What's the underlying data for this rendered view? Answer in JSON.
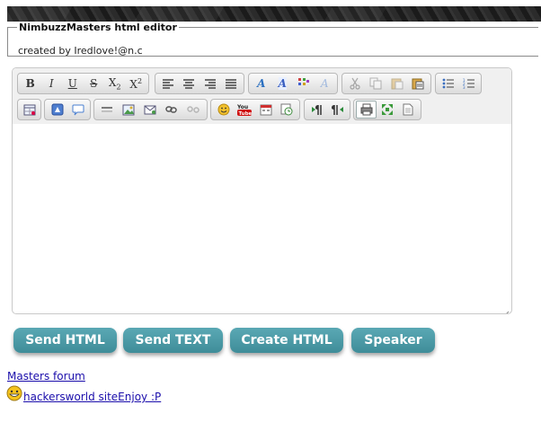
{
  "header": {
    "legend": "NimbuzzMasters html editor",
    "credit": "created by Iredlove!@n.c"
  },
  "toolbar": {
    "row1": [
      {
        "icon": "bold-icon",
        "label": "B"
      },
      {
        "icon": "italic-icon",
        "label": "I"
      },
      {
        "icon": "underline-icon",
        "label": "U"
      },
      {
        "icon": "strikethrough-icon",
        "label": "S"
      },
      {
        "icon": "subscript-icon",
        "label": "X"
      },
      {
        "icon": "superscript-icon",
        "label": "X"
      },
      {
        "icon": "align-left-icon"
      },
      {
        "icon": "align-center-icon"
      },
      {
        "icon": "align-right-icon"
      },
      {
        "icon": "align-justify-icon"
      },
      {
        "icon": "text-color-icon"
      },
      {
        "icon": "background-color-icon"
      },
      {
        "icon": "show-blocks-icon"
      },
      {
        "icon": "remove-format-icon"
      },
      {
        "icon": "cut-icon"
      },
      {
        "icon": "copy-icon"
      },
      {
        "icon": "paste-icon"
      },
      {
        "icon": "paste-text-icon"
      },
      {
        "icon": "bulleted-list-icon"
      },
      {
        "icon": "numbered-list-icon"
      }
    ],
    "row2": [
      {
        "icon": "table-icon"
      },
      {
        "icon": "flash-icon"
      },
      {
        "icon": "speech-bubble-icon"
      },
      {
        "icon": "horizontal-rule-icon"
      },
      {
        "icon": "insert-image-icon"
      },
      {
        "icon": "email-icon"
      },
      {
        "icon": "link-icon"
      },
      {
        "icon": "unlink-icon"
      },
      {
        "icon": "smiley-icon"
      },
      {
        "icon": "youtube-icon",
        "label": "You Tube"
      },
      {
        "icon": "date-icon"
      },
      {
        "icon": "time-icon"
      },
      {
        "icon": "left-to-right-icon"
      },
      {
        "icon": "right-to-left-icon"
      },
      {
        "icon": "print-icon"
      },
      {
        "icon": "maximize-icon"
      },
      {
        "icon": "source-icon"
      }
    ]
  },
  "buttons": {
    "send_html": "Send HTML",
    "send_text": "Send TEXT",
    "create_html": "Create HTML",
    "speaker": "Speaker"
  },
  "links": {
    "forum": "Masters forum",
    "site": "hackersworld siteEnjoy :P"
  },
  "colors": {
    "button_bg": "#4a98a4",
    "link": "#1a0dab"
  }
}
